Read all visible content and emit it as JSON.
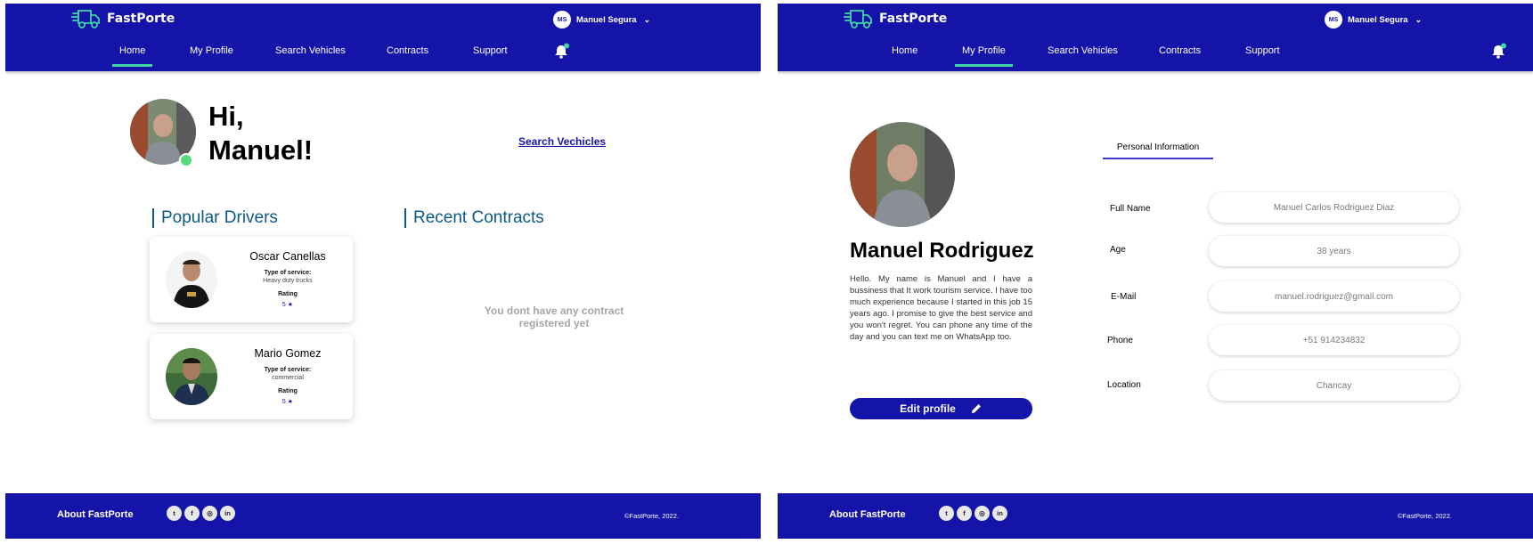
{
  "brand": {
    "name": "FastPorte"
  },
  "user": {
    "initials": "MS",
    "name": "Manuel Segura"
  },
  "nav": {
    "home": "Home",
    "profile": "My Profile",
    "search": "Search Vehicles",
    "contracts": "Contracts",
    "support": "Support"
  },
  "home": {
    "greeting_line1": "Hi,",
    "greeting_line2": "Manuel!",
    "search_link": "Search Vechicles",
    "popular_title": "Popular Drivers",
    "recent_title": "Recent Contracts",
    "empty_contracts_line1": "You dont have any contract",
    "empty_contracts_line2": "registered yet",
    "drivers": [
      {
        "name": "Oscar Canellas",
        "service_label": "Type of service:",
        "service": "Heavy duty trucks",
        "rating_label": "Rating",
        "rating": "5"
      },
      {
        "name": "Mario Gomez",
        "service_label": "Type of service:",
        "service": "commercial",
        "rating_label": "Rating",
        "rating": "5"
      }
    ]
  },
  "profile": {
    "name": "Manuel Rodriguez",
    "bio": "Hello. My name is Manuel and I have a bussiness that It work tourism service. I have too much experience because I started in this job 15 years ago. I promise to give the best service and you won't regret. You can phone any time of the day and you can text me on WhatsApp too.",
    "edit_button": "Edit profile",
    "tab": "Personal Information",
    "fields": {
      "full_name_label": "Full Name",
      "full_name": "Manuel Carlos Rodriguez Diaz",
      "age_label": "Age",
      "age": "38 years",
      "email_label": "E-Mail",
      "email": "manuel.rodriguez@gmail.com",
      "phone_label": "Phone",
      "phone": "+51 914234832",
      "location_label": "Location",
      "location": "Chancay"
    }
  },
  "footer": {
    "about": "About FastPorte",
    "copyright": "©FastPorte, 2022.",
    "social": [
      "twitter-icon",
      "facebook-icon",
      "instagram-icon",
      "linkedin-icon"
    ]
  },
  "colors": {
    "primary": "#1414a8",
    "accent": "#3fd7a5",
    "section_title": "#0b5a86",
    "online": "#5ad97f"
  }
}
